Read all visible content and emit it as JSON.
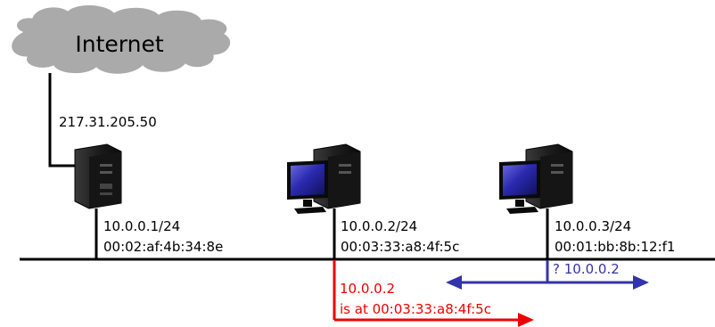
{
  "internet": {
    "label": "Internet"
  },
  "router": {
    "public_ip": "217.31.205.50",
    "ip": "10.0.0.1/24",
    "mac": "00:02:af:4b:34:8e"
  },
  "host_a": {
    "ip": "10.0.0.2/24",
    "mac": "00:03:33:a8:4f:5c"
  },
  "host_b": {
    "ip": "10.0.0.3/24",
    "mac": "00:01:bb:8b:12:f1"
  },
  "arp_request": {
    "text": "? 10.0.0.2",
    "color": "#3333aa"
  },
  "arp_reply": {
    "line1": "10.0.0.2",
    "line2": "is at 00:03:33:a8:4f:5c",
    "color": "#ee0000"
  },
  "colors": {
    "cloud": "#aaaaaa",
    "screen": "#2a2aa0",
    "tower": "#1a1a1a"
  }
}
